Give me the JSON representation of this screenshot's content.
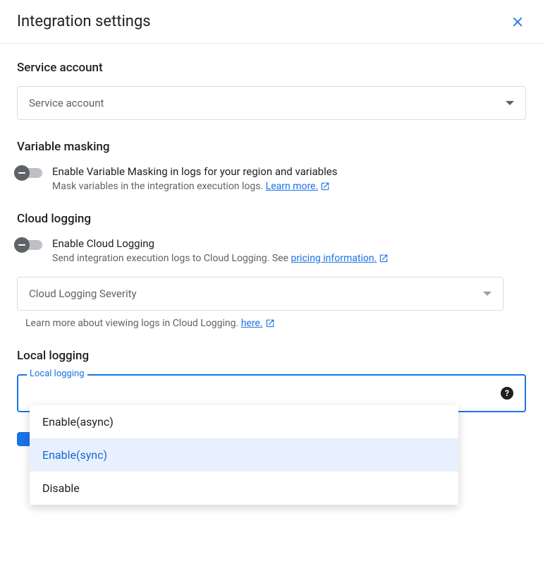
{
  "header": {
    "title": "Integration settings"
  },
  "serviceAccount": {
    "title": "Service account",
    "placeholder": "Service account"
  },
  "variableMasking": {
    "title": "Variable masking",
    "toggleLabel": "Enable Variable Masking in logs for your region and variables",
    "toggleDesc": "Mask variables in the integration execution logs. ",
    "linkText": "Learn more."
  },
  "cloudLogging": {
    "title": "Cloud logging",
    "toggleLabel": "Enable Cloud Logging",
    "toggleDesc": "Send integration execution logs to Cloud Logging. See ",
    "linkText": "pricing information.",
    "severityPlaceholder": "Cloud Logging Severity",
    "severityHelp": "Learn more about viewing logs in Cloud Logging. ",
    "severityHelpLink": "here."
  },
  "localLogging": {
    "title": "Local logging",
    "floatLabel": "Local logging",
    "options": [
      "Enable(async)",
      "Enable(sync)",
      "Disable"
    ],
    "selected": "Enable(sync)"
  }
}
